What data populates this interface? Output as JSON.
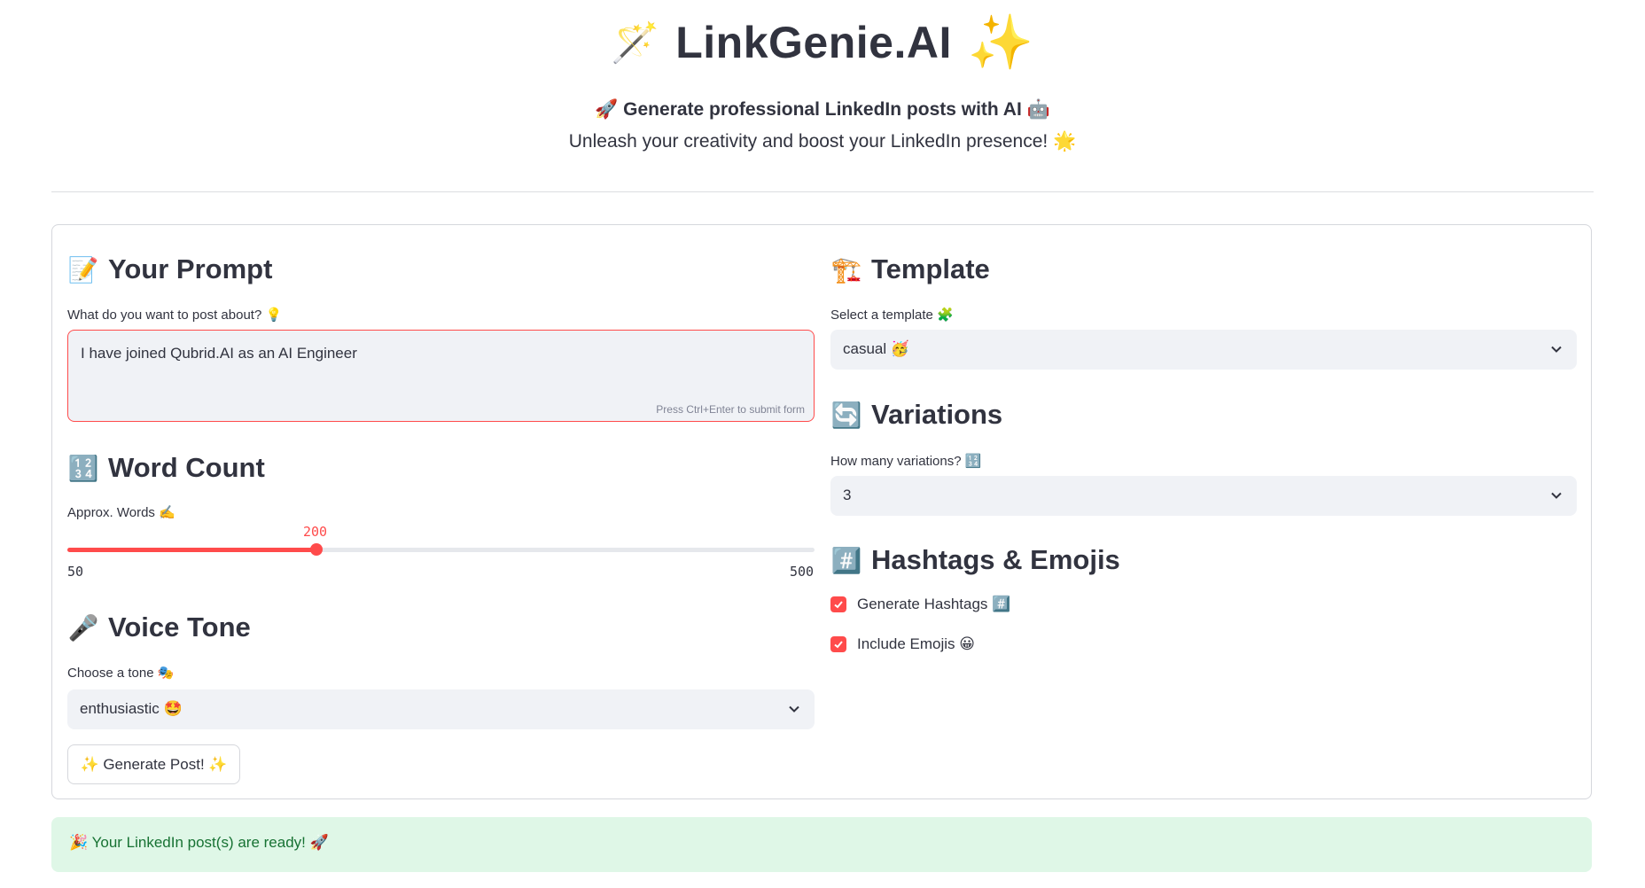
{
  "header": {
    "title": "LinkGenie.AI",
    "title_left_icon": "🪄",
    "title_right_icon": "✨",
    "subtitle": "🚀 Generate professional LinkedIn posts with AI 🤖",
    "tagline": "Unleash your creativity and boost your LinkedIn presence! 🌟"
  },
  "prompt": {
    "section_icon": "📝",
    "section_title": "Your Prompt",
    "label": "What do you want to post about? 💡",
    "value": "I have joined Qubrid.AI as an AI Engineer",
    "hint": "Press Ctrl+Enter to submit form"
  },
  "word_count": {
    "section_icon": "🔢",
    "section_title": "Word Count",
    "label": "Approx. Words ✍️",
    "value": "200",
    "min": "50",
    "max": "500",
    "fraction": 0.3333
  },
  "voice_tone": {
    "section_icon": "🎤",
    "section_title": "Voice Tone",
    "label": "Choose a tone 🎭",
    "selected": "enthusiastic 🤩"
  },
  "template": {
    "section_icon": "🏗️",
    "section_title": "Template",
    "label": "Select a template 🧩",
    "selected": "casual 🥳"
  },
  "variations": {
    "section_icon": "🔄",
    "section_title": "Variations",
    "label": "How many variations? 🔢",
    "selected": "3"
  },
  "hashtags_emojis": {
    "section_icon": "#️⃣",
    "section_title": "Hashtags & Emojis",
    "generate_hashtags_label": "Generate Hashtags #️⃣",
    "generate_hashtags_checked": true,
    "include_emojis_label": "Include Emojis 😀",
    "include_emojis_checked": true
  },
  "generate_button": {
    "label": "✨ Generate Post! ✨"
  },
  "status": {
    "message": "🎉 Your LinkedIn post(s) are ready! 🚀"
  },
  "colors": {
    "accent": "#ff4b4b",
    "success_bg": "#dff7e7",
    "success_text": "#177233"
  }
}
